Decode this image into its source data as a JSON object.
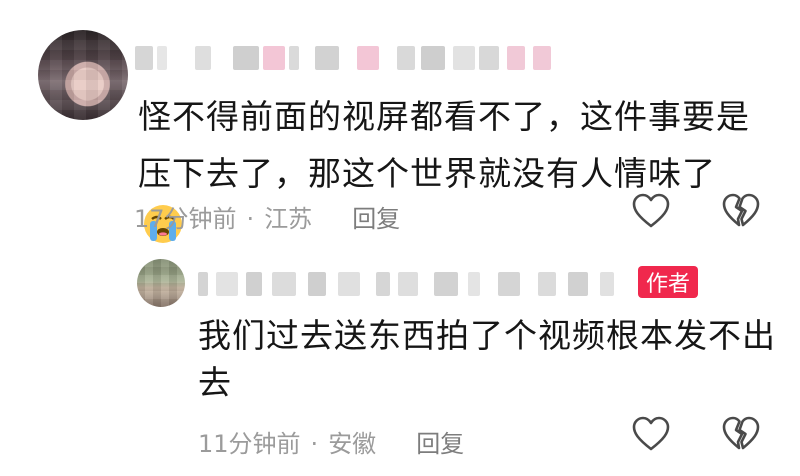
{
  "comment": {
    "text": "怪不得前面的视屏都看不了，这件事要是压下去了，那这个世界就没有人情味了",
    "emoji": "loudly-crying-face",
    "time": "17分钟前",
    "location": "江苏",
    "reply_label": "回复"
  },
  "reply": {
    "badge": "作者",
    "text": "我们过去送东西拍了个视频根本发不出去",
    "time": "11分钟前",
    "location": "安徽",
    "reply_label": "回复"
  },
  "icons": {
    "like": "heart-outline-icon",
    "dislike": "broken-heart-outline-icon"
  },
  "colors": {
    "badge": "#f0284d",
    "meta_text": "#9b9b9b",
    "icon_stroke": "#4a4a4a"
  }
}
